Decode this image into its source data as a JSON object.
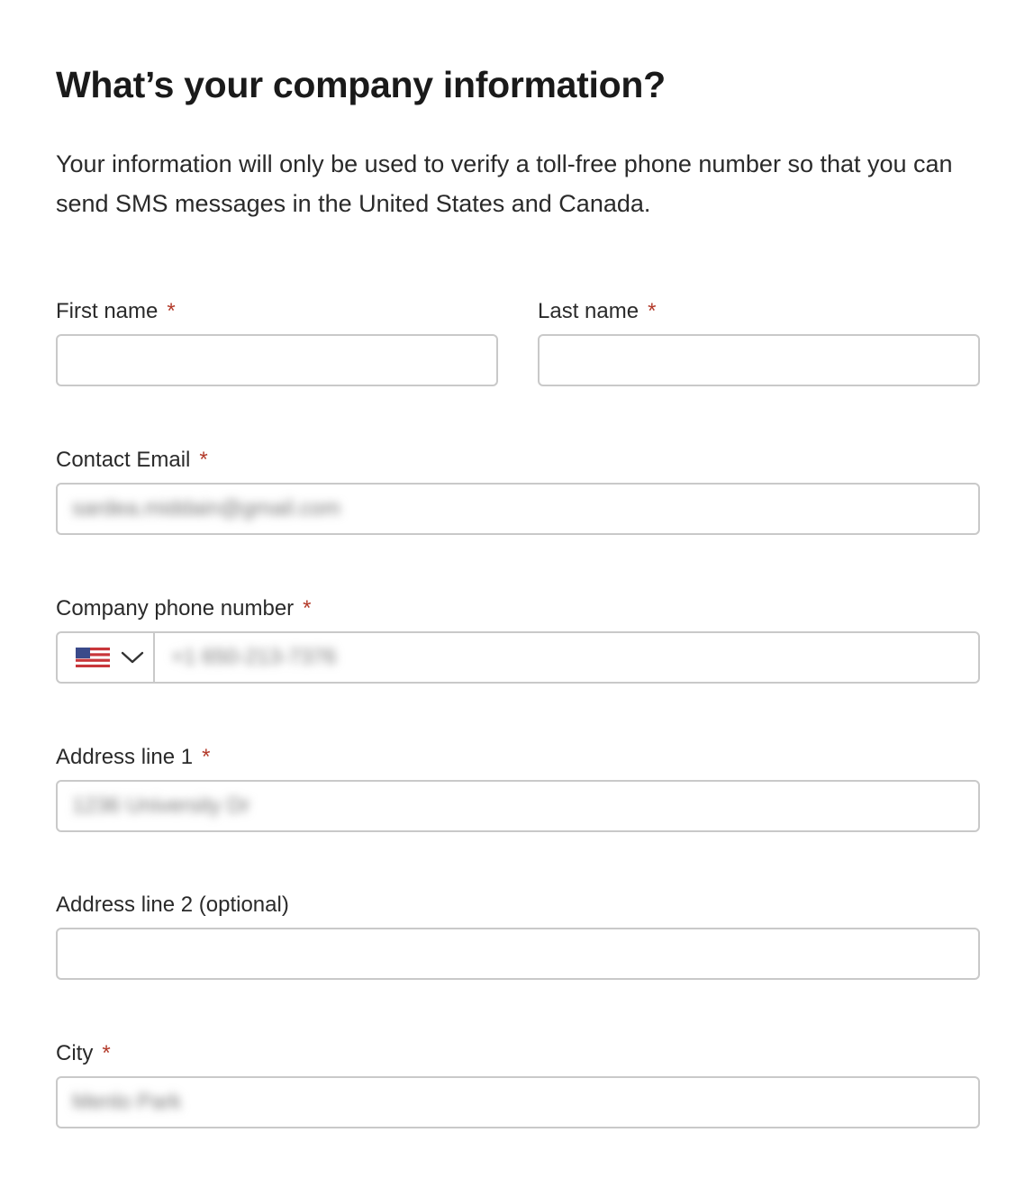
{
  "title": "What’s your company information?",
  "description": "Your information will only be used to verify a toll-free phone number so that you can send SMS messages in the United States and Canada.",
  "required_mark": "*",
  "colors": {
    "required": "#b33a2a",
    "border": "#c9c9c9",
    "text": "#1c1c1c"
  },
  "fields": {
    "first_name": {
      "label": "First name",
      "value": ""
    },
    "last_name": {
      "label": "Last name",
      "value": ""
    },
    "email": {
      "label": "Contact Email",
      "value": "sardea.middain@gmail.com"
    },
    "phone": {
      "label": "Company phone number",
      "country": "US",
      "country_icon": "us-flag-icon",
      "value": "+1 650-213-7376"
    },
    "address1": {
      "label": "Address line 1",
      "value": "1236 University Dr"
    },
    "address2": {
      "label": "Address line 2 (optional)",
      "value": ""
    },
    "city": {
      "label": "City",
      "value": "Menlo Park"
    }
  }
}
